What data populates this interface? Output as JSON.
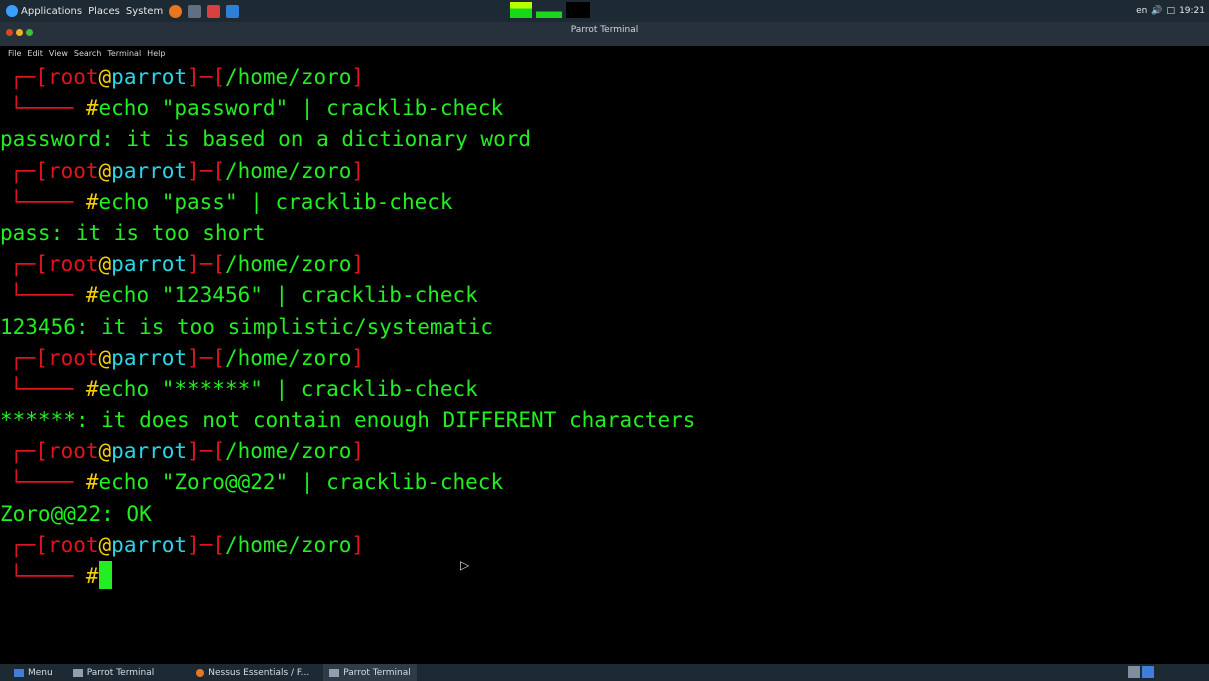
{
  "top_panel": {
    "menus": [
      "Applications",
      "Places",
      "System"
    ],
    "launchers": [
      "firefox-icon",
      "terminal-icon",
      "text-editor-icon",
      "vscode-icon"
    ],
    "tray": {
      "lang": "en",
      "time": "19:21"
    }
  },
  "window": {
    "title": "Parrot Terminal",
    "menu": [
      "File",
      "Edit",
      "View",
      "Search",
      "Terminal",
      "Help"
    ]
  },
  "terminal": {
    "prompt": {
      "user": "root",
      "at": "@",
      "host": "parrot",
      "path": "/home/zoro",
      "symbol": "#"
    },
    "entries": [
      {
        "command": "echo \"password\" | cracklib-check",
        "output": "password: it is based on a dictionary word"
      },
      {
        "command": "echo \"pass\" | cracklib-check",
        "output": "pass: it is too short"
      },
      {
        "command": "echo \"123456\" | cracklib-check",
        "output": "123456: it is too simplistic/systematic"
      },
      {
        "command": "echo \"******\" | cracklib-check",
        "output": "******: it does not contain enough DIFFERENT characters"
      },
      {
        "command": "echo \"Zoro@@22\" | cracklib-check",
        "output": "Zoro@@22: OK"
      }
    ]
  },
  "bottom_panel": {
    "menu_label": "Menu",
    "tasks": [
      "Parrot Terminal",
      "Nessus Essentials / F...",
      "Parrot Terminal"
    ]
  },
  "colors": {
    "prompt_red": "#e0141e",
    "prompt_yellow": "#f5d000",
    "prompt_cyan": "#28d8e8",
    "output_green": "#22ee22"
  }
}
